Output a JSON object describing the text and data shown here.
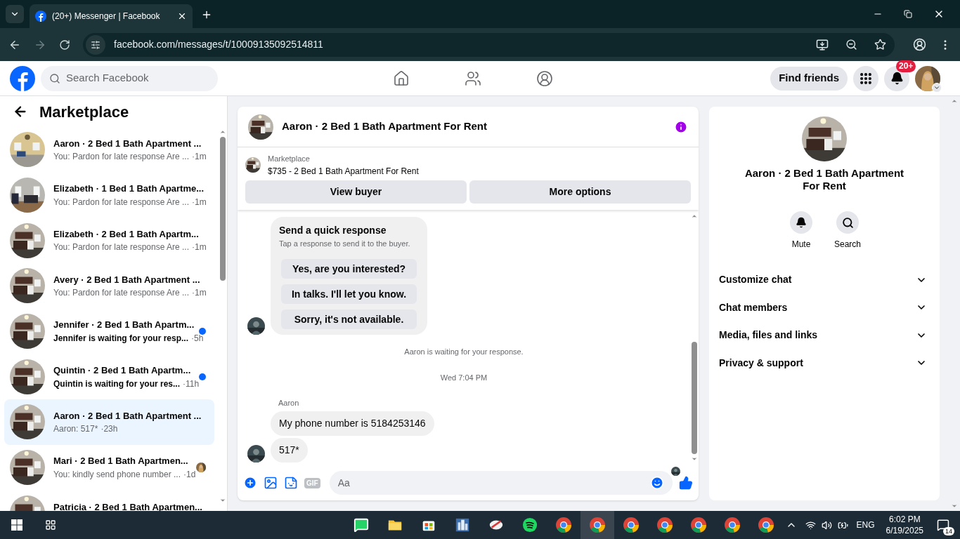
{
  "browser": {
    "tab_title": "(20+) Messenger | Facebook",
    "url": "facebook.com/messages/t/10009135092514811"
  },
  "header": {
    "search_placeholder": "Search Facebook",
    "find_friends": "Find friends",
    "notification_badge": "20+"
  },
  "sidebar": {
    "title": "Marketplace",
    "conversations": [
      {
        "title": "Aaron · 2 Bed 1 Bath Apartment ...",
        "preview": "You: Pardon for late response Are ...",
        "time": "·1m",
        "unread": false,
        "selected": false
      },
      {
        "title": "Elizabeth · 1 Bed 1 Bath Apartme...",
        "preview": "You: Pardon for late response Are ...",
        "time": "·1m",
        "unread": false,
        "selected": false
      },
      {
        "title": "Elizabeth · 2 Bed 1 Bath Apartm...",
        "preview": "You: Pardon for late response Are ...",
        "time": "·1m",
        "unread": false,
        "selected": false
      },
      {
        "title": "Avery · 2 Bed 1 Bath Apartment ...",
        "preview": "You: Pardon for late response Are ...",
        "time": "·1m",
        "unread": false,
        "selected": false
      },
      {
        "title": "Jennifer · 2 Bed 1 Bath Apartm...",
        "preview": "Jennifer is waiting for your resp...",
        "time": "·5h",
        "unread": true,
        "selected": false
      },
      {
        "title": "Quintin · 2 Bed 1 Bath Apartm...",
        "preview": "Quintin is waiting for your res...",
        "time": "·11h",
        "unread": true,
        "selected": false
      },
      {
        "title": "Aaron · 2 Bed 1 Bath Apartment ...",
        "preview": "Aaron: 517*",
        "time": "·23h",
        "unread": false,
        "selected": true
      },
      {
        "title": "Mari · 2 Bed 1 Bath Apartmen...",
        "preview": "You: kindly send phone number ...",
        "time": "·1d",
        "unread": false,
        "selected": false,
        "seen": true
      },
      {
        "title": "Patricia · 2 Bed 1 Bath Apartmen...",
        "selected": false
      }
    ]
  },
  "chat": {
    "title": "Aaron · 2 Bed 1 Bath Apartment For Rent",
    "listing_label": "Marketplace",
    "listing": "$735 - 2 Bed 1 Bath Apartment For Rent",
    "buttons": [
      "View buyer",
      "More options"
    ],
    "quick_response": {
      "title": "Send a quick response",
      "subtitle": "Tap a response to send it to the buyer.",
      "options": [
        "Yes, are you interested?",
        "In talks. I'll let you know.",
        "Sorry, it's not available."
      ]
    },
    "notice": "Aaron is waiting for your response.",
    "timestamp": "Wed 7:04 PM",
    "sender": "Aaron",
    "messages": [
      "My phone number is 5184253146",
      "517*"
    ],
    "composer_placeholder": "Aa",
    "gif_label": "GIF"
  },
  "details": {
    "title": "Aaron · 2 Bed 1 Bath Apartment For Rent",
    "actions": [
      "Mute",
      "Search"
    ],
    "sections": [
      {
        "label": "Customize chat",
        "expanded": false
      },
      {
        "label": "Chat members",
        "expanded": false
      },
      {
        "label": "Media, files and links",
        "expanded": false
      },
      {
        "label": "Privacy & support",
        "expanded": false
      }
    ]
  },
  "taskbar": {
    "language": "ENG",
    "time": "6:02 PM",
    "date": "6/19/2025",
    "notifications": "14"
  }
}
